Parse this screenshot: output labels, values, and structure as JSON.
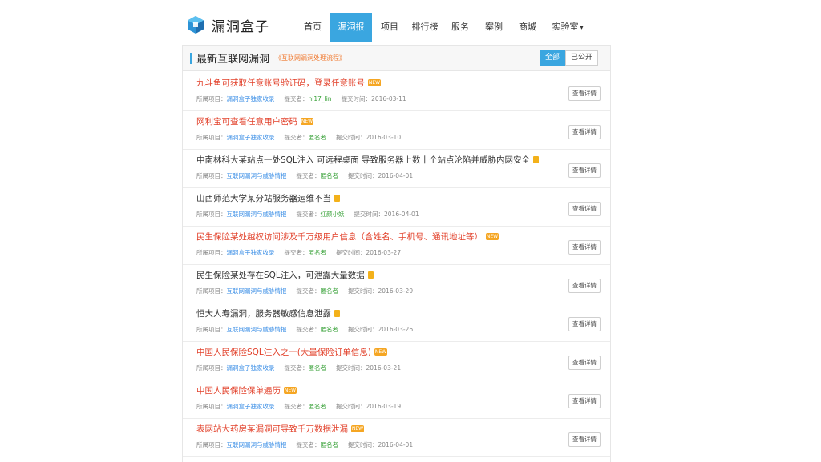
{
  "header": {
    "logo_text": "漏洞盒子",
    "nav": [
      {
        "label": "首页",
        "active": false
      },
      {
        "label": "漏洞报",
        "active": true
      },
      {
        "label": "项目",
        "active": false
      },
      {
        "label": "排行榜",
        "active": false
      },
      {
        "label": "服务",
        "active": false
      },
      {
        "label": "案例",
        "active": false
      },
      {
        "label": "商城",
        "active": false
      },
      {
        "label": "实验室",
        "active": false
      }
    ],
    "nav_caret": "▾"
  },
  "panel": {
    "title": "最新互联网漏洞",
    "subtitle": "《互联网漏洞处理流程》",
    "toggle": {
      "all": "全部",
      "public": "已公开"
    }
  },
  "meta_labels": {
    "project": "所属项目：",
    "submitter": "提交者：",
    "time": "提交时间："
  },
  "detail_label": "查看详情",
  "badge_text": "NEW",
  "rows": [
    {
      "title": "九斗鱼可获取任意账号验证码，登录任意账号",
      "red": true,
      "tag": "new",
      "project": "漏洞盒子独家收录",
      "submitter": "hi17_lin",
      "time": "2016-03-11"
    },
    {
      "title": "网利宝可查看任意用户密码",
      "red": true,
      "tag": "new",
      "project": "漏洞盒子独家收录",
      "submitter": "匿名者",
      "time": "2016-03-10"
    },
    {
      "title": "中南林科大某站点一处SQL注入 可远程桌面 导致服务器上数十个站点沦陷并威胁内网安全",
      "red": false,
      "tag": "lock",
      "project": "互联网漏洞与威胁情报",
      "submitter": "匿名者",
      "time": "2016-04-01"
    },
    {
      "title": "山西师范大学某分站服务器运维不当",
      "red": false,
      "tag": "lock",
      "project": "互联网漏洞与威胁情报",
      "submitter": "红颜小妖",
      "time": "2016-04-01"
    },
    {
      "title": "民生保险某处越权访问涉及千万级用户信息（含姓名、手机号、通讯地址等）",
      "red": true,
      "tag": "new",
      "project": "漏洞盒子独家收录",
      "submitter": "匿名者",
      "time": "2016-03-27"
    },
    {
      "title": "民生保险某处存在SQL注入，可泄露大量数据",
      "red": false,
      "tag": "lock",
      "project": "互联网漏洞与威胁情报",
      "submitter": "匿名者",
      "time": "2016-03-29"
    },
    {
      "title": "恒大人寿漏洞，服务器敏感信息泄露",
      "red": false,
      "tag": "lock",
      "project": "互联网漏洞与威胁情报",
      "submitter": "匿名者",
      "time": "2016-03-26"
    },
    {
      "title": "中国人民保险SQL注入之一(大量保险订单信息)",
      "red": true,
      "tag": "new",
      "project": "漏洞盒子独家收录",
      "submitter": "匿名者",
      "time": "2016-03-21"
    },
    {
      "title": "中国人民保险保单遍历",
      "red": true,
      "tag": "new",
      "project": "漏洞盒子独家收录",
      "submitter": "匿名者",
      "time": "2016-03-19"
    },
    {
      "title": "表网站大药房某漏洞可导致千万数据泄漏",
      "red": true,
      "tag": "new",
      "project": "互联网漏洞与威胁情报",
      "submitter": "匿名者",
      "time": "2016-04-01"
    }
  ],
  "colors": {
    "accent": "#3aa6e0",
    "red_title": "#e2402a",
    "badge": "#f5a623",
    "project_link": "#3a8ee6",
    "submitter_link": "#3aa23a"
  }
}
